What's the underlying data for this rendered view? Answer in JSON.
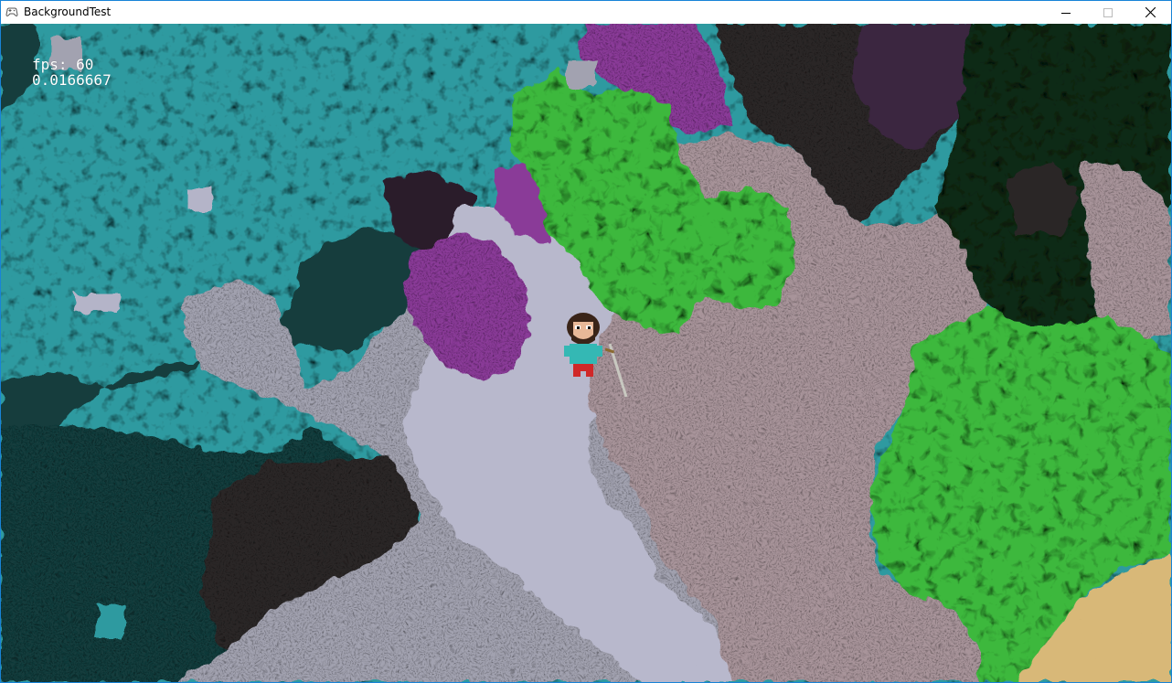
{
  "window": {
    "title": "BackgroundTest",
    "icon": "gamepad-icon",
    "controls": [
      "minimize-icon",
      "maximize-icon",
      "close-icon"
    ]
  },
  "hud": {
    "fps_line": "fps: 60",
    "frame_time": "0.0166667"
  },
  "colors": {
    "titlebar_border": "#1883d7",
    "teal_water": "#2f9aa0",
    "dark_teal": "#123c3c",
    "lavender_stone": "#b4b4c8",
    "gray_stone": "#9898a4",
    "rose_dirt": "#a8949a",
    "magenta": "#8a3a98",
    "dark_purple": "#2c1c2c",
    "green_grass": "#3cb83c",
    "dark_green": "#0f2a14",
    "charcoal": "#2c2828",
    "sand": "#d8b878"
  }
}
